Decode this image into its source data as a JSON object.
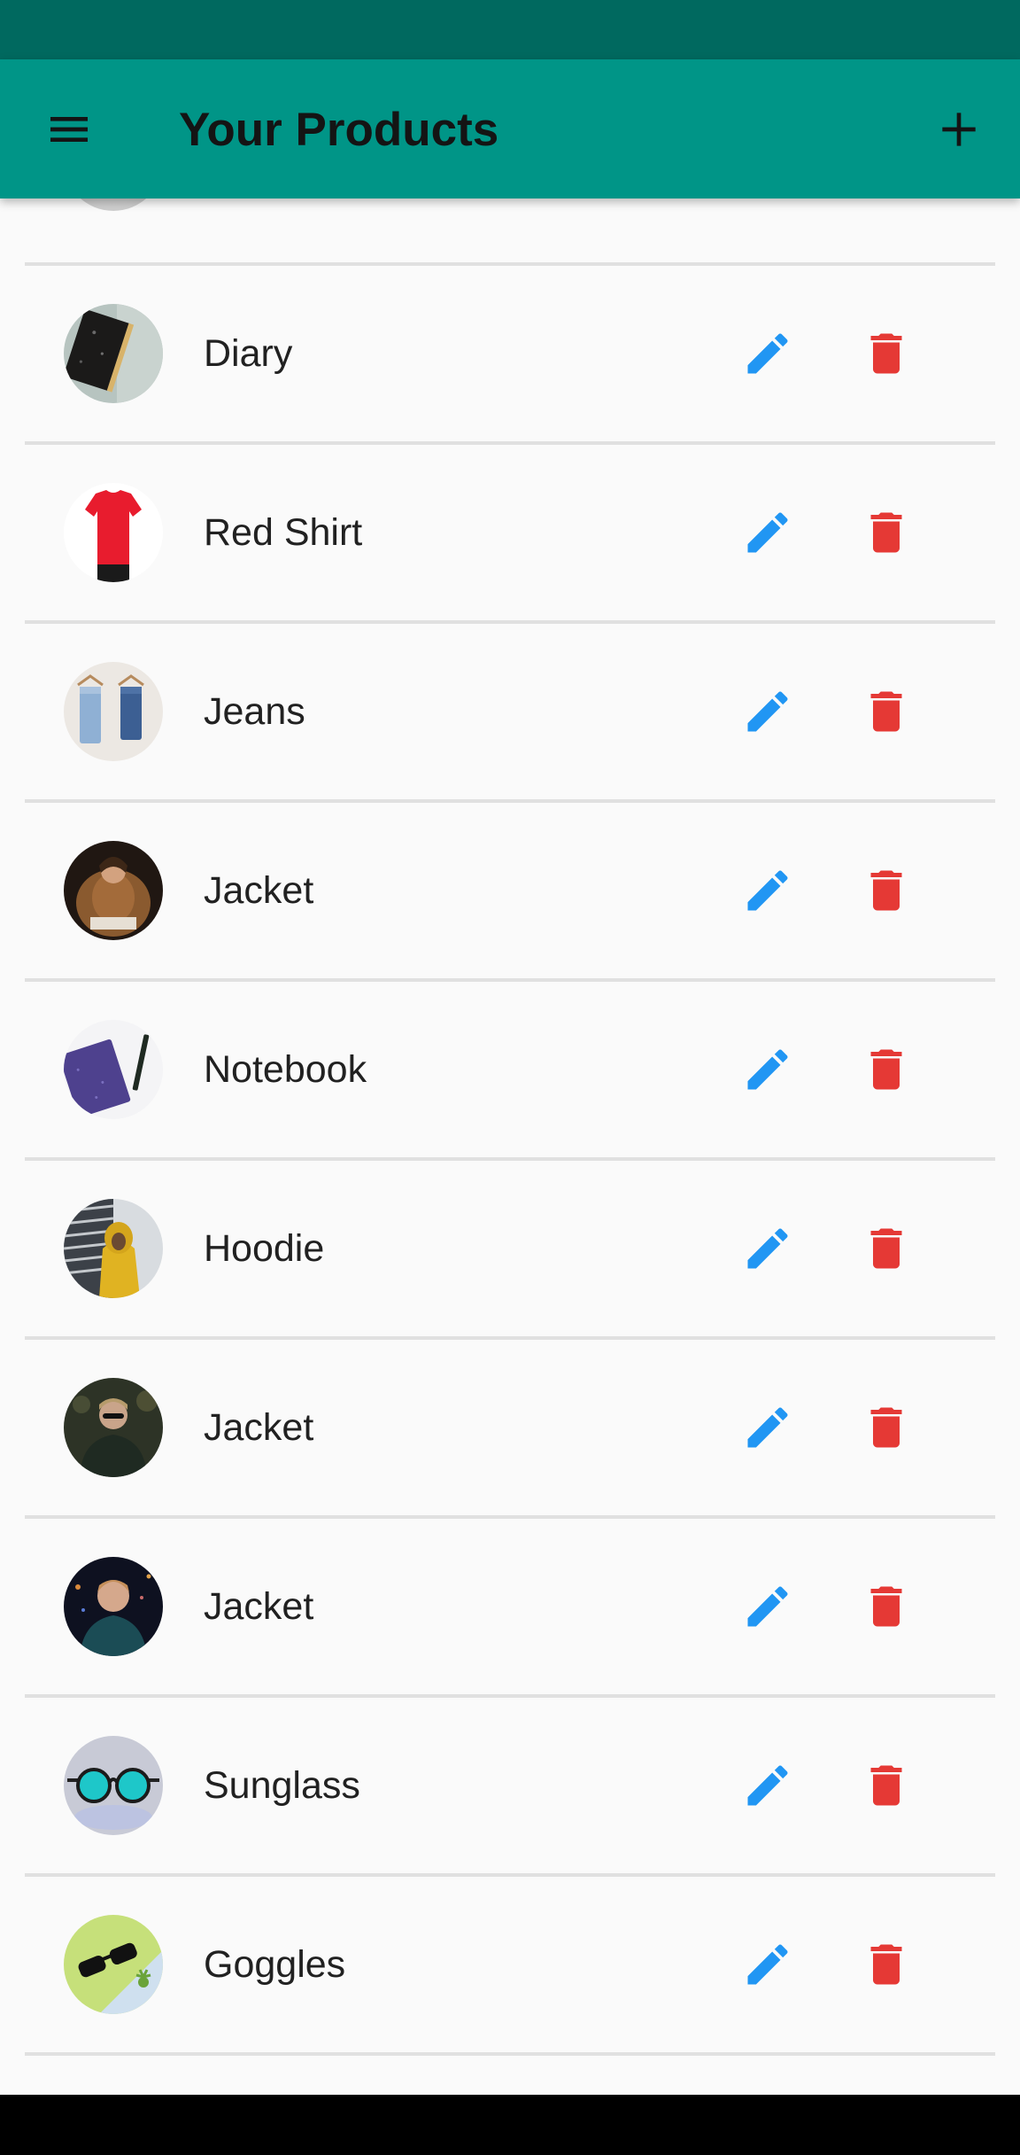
{
  "app_bar": {
    "title": "Your Products",
    "menu_icon": "menu-icon",
    "add_icon": "add-icon",
    "background": "#009587",
    "status_bar_color": "#00695f"
  },
  "products": [
    {
      "name": "Diary",
      "image": "diary-thumbnail"
    },
    {
      "name": "Red Shirt",
      "image": "red-shirt-thumbnail"
    },
    {
      "name": "Jeans",
      "image": "jeans-thumbnail"
    },
    {
      "name": "Jacket",
      "image": "brown-fur-jacket-thumbnail"
    },
    {
      "name": "Notebook",
      "image": "notebook-thumbnail"
    },
    {
      "name": "Hoodie",
      "image": "hoodie-thumbnail"
    },
    {
      "name": "Jacket",
      "image": "dark-jacket-thumbnail"
    },
    {
      "name": "Jacket",
      "image": "night-jacket-thumbnail"
    },
    {
      "name": "Sunglass",
      "image": "sunglass-thumbnail"
    },
    {
      "name": "Goggles",
      "image": "goggles-thumbnail"
    }
  ],
  "actions": {
    "edit_icon": "edit-icon",
    "delete_icon": "delete-icon",
    "edit_color": "#2196f3",
    "delete_color": "#e53935"
  }
}
